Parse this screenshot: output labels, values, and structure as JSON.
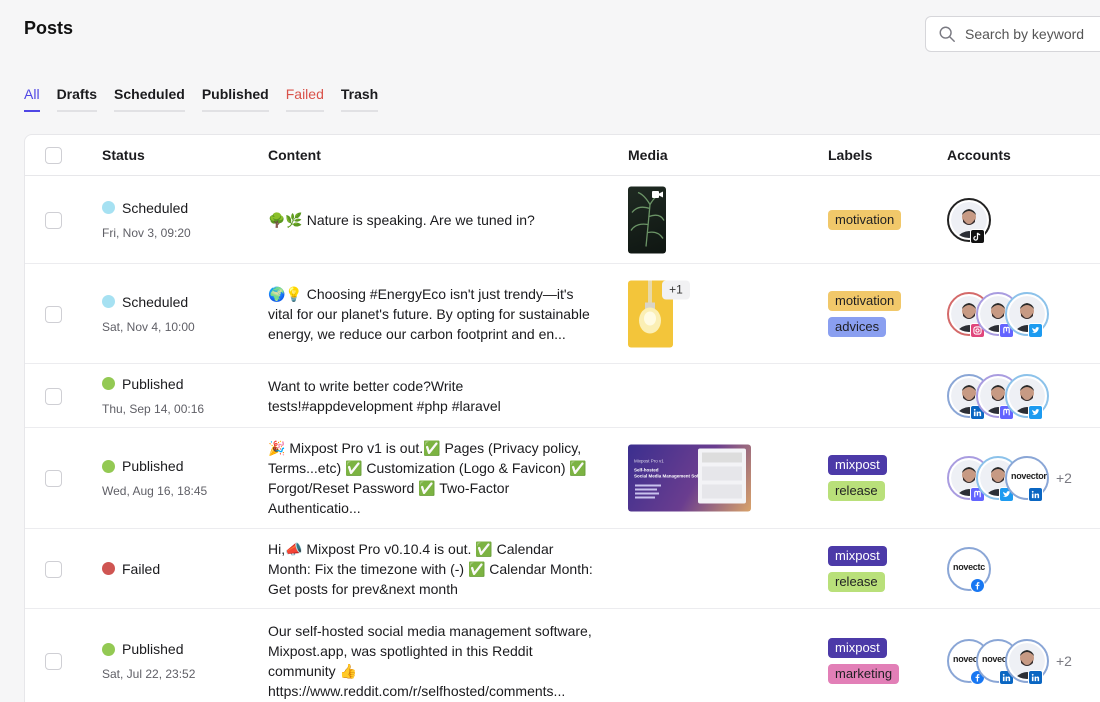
{
  "header": {
    "title": "Posts"
  },
  "search": {
    "placeholder": "Search by keyword",
    "icon": "search-icon"
  },
  "tabs": [
    {
      "label": "All",
      "state": "active"
    },
    {
      "label": "Drafts"
    },
    {
      "label": "Scheduled"
    },
    {
      "label": "Published"
    },
    {
      "label": "Failed",
      "state": "failed"
    },
    {
      "label": "Trash"
    }
  ],
  "table": {
    "columns": [
      "Status",
      "Content",
      "Media",
      "Labels",
      "Accounts"
    ],
    "rows": [
      {
        "status": "Scheduled",
        "status_color": "#a6e1f2",
        "date": "Fri, Nov 3, 09:20",
        "content": "🌳🌿 Nature is speaking. Are we tuned in?",
        "media": "plant-video-thumbnail",
        "labels": [
          {
            "text": "motivation",
            "bg": "#f1c86a"
          }
        ],
        "accounts": [
          {
            "network": "tiktok"
          }
        ],
        "more": ""
      },
      {
        "status": "Scheduled",
        "status_color": "#a6e1f2",
        "date": "Sat, Nov 4, 10:00",
        "content": "🌍💡 Choosing #EnergyEco isn't just trendy—it's vital for our planet's future. By opting for sustainable energy, we reduce our carbon footprint and en...",
        "media": "lightbulb-image-thumbnail",
        "media_more": "+1",
        "labels": [
          {
            "text": "motivation",
            "bg": "#f1c86a"
          },
          {
            "text": "advices",
            "bg": "#8a9ff0"
          }
        ],
        "accounts": [
          {
            "network": "instagram"
          },
          {
            "network": "mastodon"
          },
          {
            "network": "twitter"
          }
        ],
        "more": ""
      },
      {
        "status": "Published",
        "status_color": "#93c953",
        "date": "Thu, Sep 14, 00:16",
        "content": "Want to write better code?Write tests!#appdevelopment #php #laravel",
        "media": "",
        "labels": [],
        "accounts": [
          {
            "network": "linkedin"
          },
          {
            "network": "mastodon"
          },
          {
            "network": "twitter"
          }
        ],
        "more": ""
      },
      {
        "status": "Published",
        "status_color": "#93c953",
        "date": "Wed, Aug 16, 18:45",
        "content": "🎉 Mixpost Pro v1 is out.✅ Pages (Privacy policy, Terms...etc) ✅ Customization (Logo & Favicon) ✅ Forgot/Reset Password ✅ Two-Factor Authenticatio...",
        "media": "mixpost-pro-banner-thumbnail",
        "banner_lines": [
          "Mixpost Pro v1",
          "Self-hosted",
          "Social Media Management Software"
        ],
        "labels": [
          {
            "text": "mixpost",
            "bg": "#4c3aa8",
            "fg": "#ffffff"
          },
          {
            "text": "release",
            "bg": "#b9e07a"
          }
        ],
        "accounts": [
          {
            "network": "mastodon"
          },
          {
            "network": "twitter"
          },
          {
            "network": "linkedin",
            "brand": "novector"
          }
        ],
        "more": "+2"
      },
      {
        "status": "Failed",
        "status_color": "#cf5552",
        "date": "",
        "content": "Hi,📣 Mixpost Pro v0.10.4 is out. ✅ Calendar Month: Fix the timezone with (-) ✅ Calendar Month: Get posts for prev&next month",
        "media": "",
        "labels": [
          {
            "text": "mixpost",
            "bg": "#4c3aa8",
            "fg": "#ffffff"
          },
          {
            "text": "release",
            "bg": "#b9e07a"
          }
        ],
        "accounts": [
          {
            "network": "facebook",
            "brand": "novectc"
          }
        ],
        "more": ""
      },
      {
        "status": "Published",
        "status_color": "#93c953",
        "date": "Sat, Jul 22, 23:52",
        "content": "Our self-hosted social media management software, Mixpost.app, was spotlighted in this Reddit community 👍 https://www.reddit.com/r/selfhosted/comments...",
        "media": "",
        "labels": [
          {
            "text": "mixpost",
            "bg": "#4c3aa8",
            "fg": "#ffffff"
          },
          {
            "text": "marketing",
            "bg": "#e27fb7"
          }
        ],
        "accounts": [
          {
            "network": "facebook",
            "brand": "novec"
          },
          {
            "network": "linkedin",
            "brand": "novect"
          },
          {
            "network": "linkedin"
          }
        ],
        "more": "+2"
      }
    ]
  }
}
